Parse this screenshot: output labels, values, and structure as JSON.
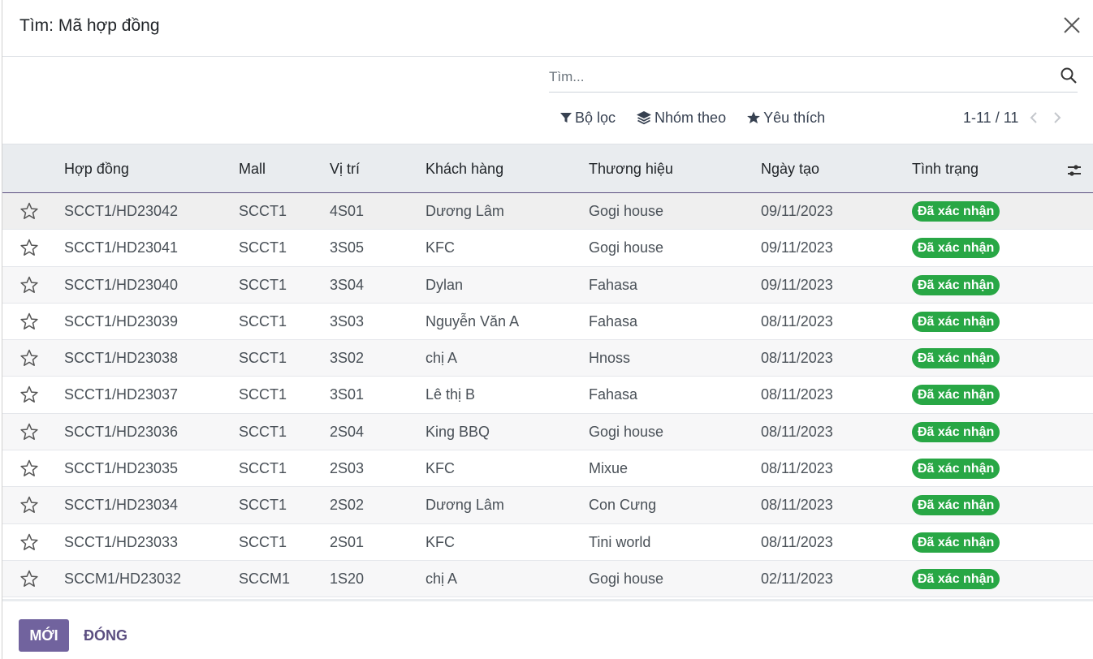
{
  "dialog": {
    "title": "Tìm: Mã hợp đồng"
  },
  "search": {
    "placeholder": "Tìm...",
    "value": ""
  },
  "toolbar": {
    "filter_label": "Bộ lọc",
    "group_label": "Nhóm theo",
    "favorite_label": "Yêu thích"
  },
  "pager": {
    "text": "1-11 / 11"
  },
  "table": {
    "headers": {
      "contract": "Hợp đồng",
      "mall": "Mall",
      "position": "Vị trí",
      "customer": "Khách hàng",
      "brand": "Thương hiệu",
      "created": "Ngày tạo",
      "status": "Tình trạng"
    },
    "rows": [
      {
        "contract": "SCCT1/HD23042",
        "mall": "SCCT1",
        "position": "4S01",
        "customer": "Dương Lâm",
        "brand": "Gogi house",
        "created": "09/11/2023",
        "status": "Đã xác nhận"
      },
      {
        "contract": "SCCT1/HD23041",
        "mall": "SCCT1",
        "position": "3S05",
        "customer": "KFC",
        "brand": "Gogi house",
        "created": "09/11/2023",
        "status": "Đã xác nhận"
      },
      {
        "contract": "SCCT1/HD23040",
        "mall": "SCCT1",
        "position": "3S04",
        "customer": "Dylan",
        "brand": "Fahasa",
        "created": "09/11/2023",
        "status": "Đã xác nhận"
      },
      {
        "contract": "SCCT1/HD23039",
        "mall": "SCCT1",
        "position": "3S03",
        "customer": "Nguyễn Văn A",
        "brand": "Fahasa",
        "created": "08/11/2023",
        "status": "Đã xác nhận"
      },
      {
        "contract": "SCCT1/HD23038",
        "mall": "SCCT1",
        "position": "3S02",
        "customer": "chị A",
        "brand": "Hnoss",
        "created": "08/11/2023",
        "status": "Đã xác nhận"
      },
      {
        "contract": "SCCT1/HD23037",
        "mall": "SCCT1",
        "position": "3S01",
        "customer": "Lê thị B",
        "brand": "Fahasa",
        "created": "08/11/2023",
        "status": "Đã xác nhận"
      },
      {
        "contract": "SCCT1/HD23036",
        "mall": "SCCT1",
        "position": "2S04",
        "customer": "King BBQ",
        "brand": "Gogi house",
        "created": "08/11/2023",
        "status": "Đã xác nhận"
      },
      {
        "contract": "SCCT1/HD23035",
        "mall": "SCCT1",
        "position": "2S03",
        "customer": "KFC",
        "brand": "Mixue",
        "created": "08/11/2023",
        "status": "Đã xác nhận"
      },
      {
        "contract": "SCCT1/HD23034",
        "mall": "SCCT1",
        "position": "2S02",
        "customer": "Dương Lâm",
        "brand": "Con Cưng",
        "created": "08/11/2023",
        "status": "Đã xác nhận"
      },
      {
        "contract": "SCCT1/HD23033",
        "mall": "SCCT1",
        "position": "2S01",
        "customer": "KFC",
        "brand": "Tini world",
        "created": "08/11/2023",
        "status": "Đã xác nhận"
      },
      {
        "contract": "SCCM1/HD23032",
        "mall": "SCCM1",
        "position": "1S20",
        "customer": "chị A",
        "brand": "Gogi house",
        "created": "02/11/2023",
        "status": "Đã xác nhận"
      }
    ]
  },
  "footer": {
    "new_label": "MỚI",
    "close_label": "ĐÓNG"
  },
  "colors": {
    "primary": "#71639e",
    "success": "#28a745",
    "header_bg": "#e9ecef"
  }
}
